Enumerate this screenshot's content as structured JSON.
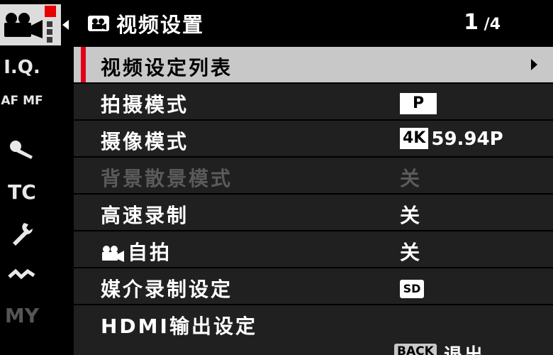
{
  "sidebar": {
    "items": [
      {
        "label": "I.Q."
      },
      {
        "label": "AF MF"
      },
      {
        "label": "TC"
      },
      {
        "label": "MY"
      }
    ]
  },
  "header": {
    "title": "视频设置",
    "page_current": "1",
    "page_total": "4"
  },
  "menu": {
    "items": [
      {
        "label": "视频设定列表"
      },
      {
        "label": "拍摄模式",
        "value": "P"
      },
      {
        "label": "摄像模式",
        "badge": "4K",
        "value": "59.94P"
      },
      {
        "label": "背景散景模式",
        "value": "关"
      },
      {
        "label": "高速录制",
        "value": "关"
      },
      {
        "label": "自拍",
        "value": "关"
      },
      {
        "label": "媒介录制设定",
        "value": "SD"
      },
      {
        "label": "HDMI输出设定"
      }
    ]
  },
  "footer": {
    "back_badge": "BACK",
    "back_label": "退出"
  },
  "colors": {
    "accent_red": "#e0001b",
    "selected_bg": "#c8c8c8",
    "row_bg": "#202020",
    "disabled_text": "#5a5a5a"
  }
}
